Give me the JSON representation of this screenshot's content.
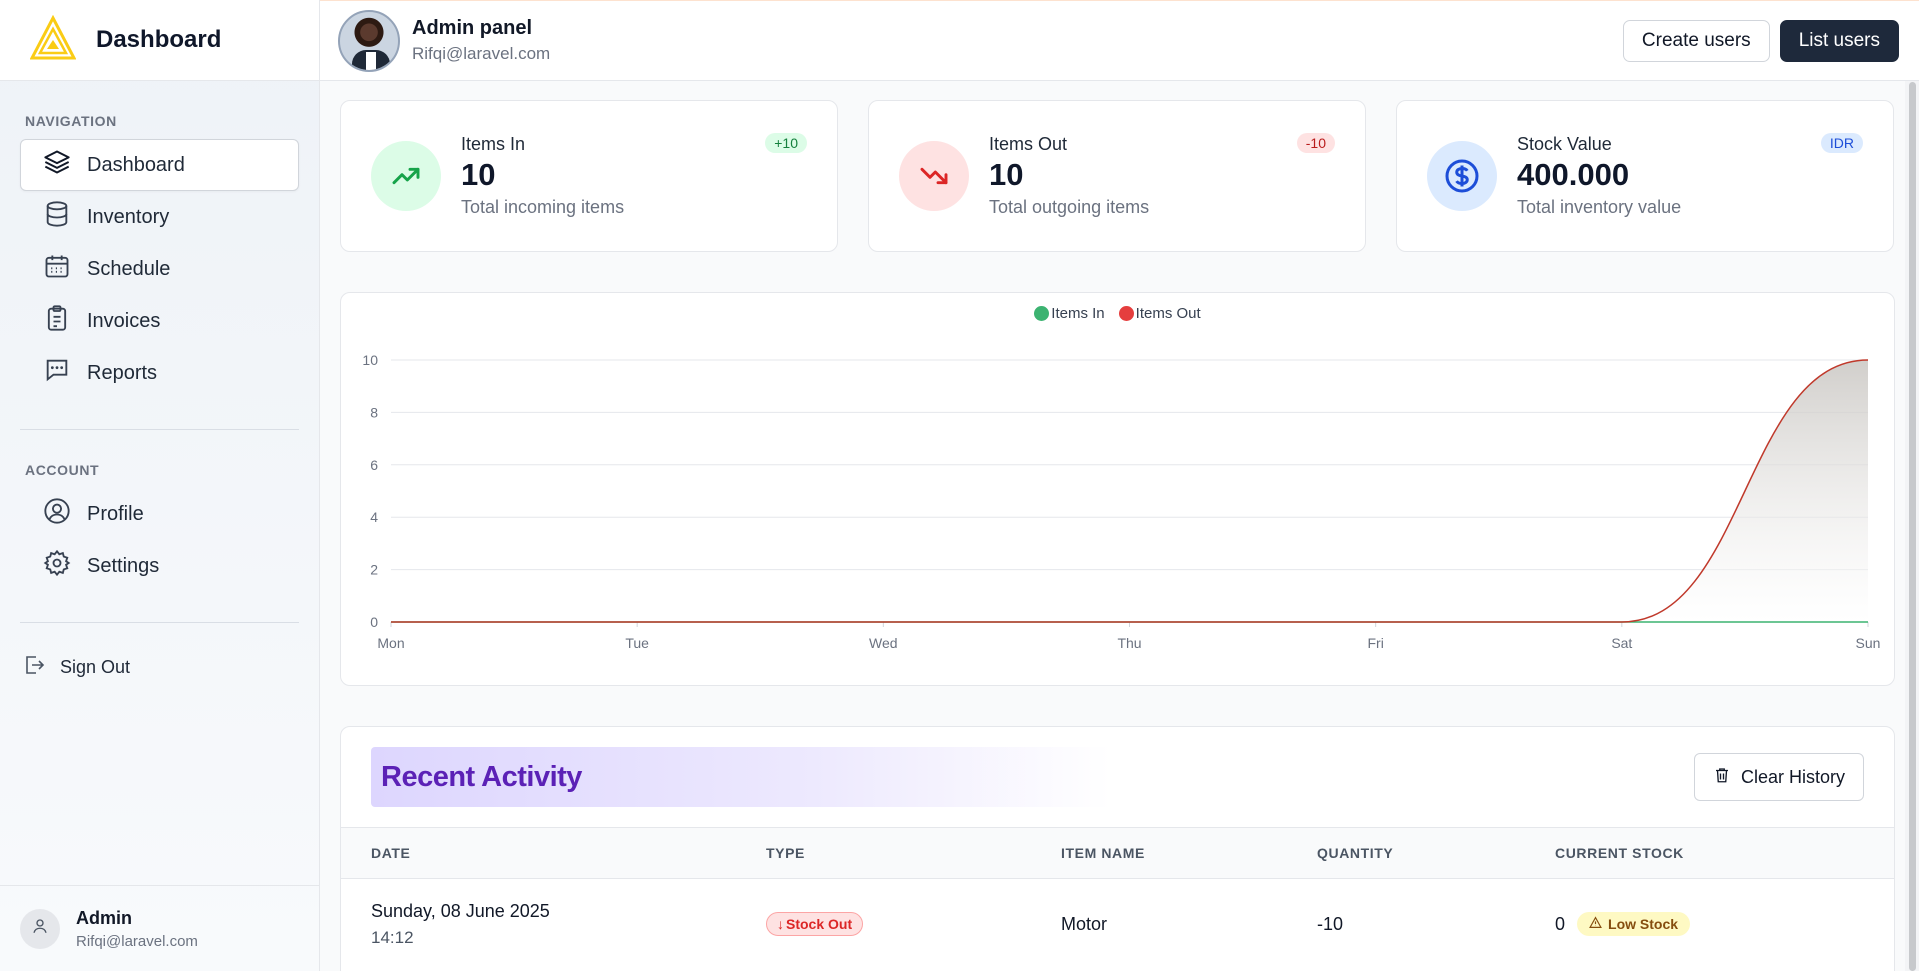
{
  "brand": {
    "title": "Dashboard",
    "accent": "#facc15"
  },
  "sidebar": {
    "navigation_label": "NAVIGATION",
    "nav_items": [
      {
        "label": "Dashboard",
        "icon": "layers-icon",
        "active": true
      },
      {
        "label": "Inventory",
        "icon": "database-icon",
        "active": false
      },
      {
        "label": "Schedule",
        "icon": "calendar-icon",
        "active": false
      },
      {
        "label": "Invoices",
        "icon": "clipboard-icon",
        "active": false
      },
      {
        "label": "Reports",
        "icon": "chat-icon",
        "active": false
      }
    ],
    "account_label": "ACCOUNT",
    "account_items": [
      {
        "label": "Profile",
        "icon": "user-circle-icon"
      },
      {
        "label": "Settings",
        "icon": "gear-icon"
      }
    ],
    "sign_out": "Sign Out",
    "user": {
      "name": "Admin",
      "email": "Rifqi@laravel.com"
    }
  },
  "header": {
    "title": "Admin panel",
    "email": "Rifqi@laravel.com",
    "create_users": "Create users",
    "list_users": "List users"
  },
  "stats": [
    {
      "label": "Items In",
      "value": "10",
      "sub": "Total incoming items",
      "badge": "+10",
      "icon": "trending-up-icon",
      "color": "#16a34a"
    },
    {
      "label": "Items Out",
      "value": "10",
      "sub": "Total outgoing items",
      "badge": "-10",
      "icon": "trending-down-icon",
      "color": "#dc2626"
    },
    {
      "label": "Stock Value",
      "value": "400.000",
      "sub": "Total inventory value",
      "badge": "IDR",
      "icon": "dollar-icon",
      "color": "#1d4ed8"
    }
  ],
  "chart_data": {
    "type": "area",
    "categories": [
      "Mon",
      "Tue",
      "Wed",
      "Thu",
      "Fri",
      "Sat",
      "Sun"
    ],
    "series": [
      {
        "name": "Items In",
        "values": [
          0,
          0,
          0,
          0,
          0,
          0,
          0
        ],
        "color": "#3cb371"
      },
      {
        "name": "Items Out",
        "values": [
          0,
          0,
          0,
          0,
          0,
          0,
          10
        ],
        "color": "#e53e3e"
      }
    ],
    "ylim": [
      0,
      10
    ],
    "yticks": [
      "0",
      "2",
      "4",
      "6",
      "8",
      "10"
    ],
    "grid": true,
    "legend": "top-center"
  },
  "activity": {
    "title": "Recent Activity",
    "clear_button": "Clear History",
    "columns": [
      "DATE",
      "TYPE",
      "ITEM NAME",
      "QUANTITY",
      "CURRENT STOCK"
    ],
    "rows": [
      {
        "date": "Sunday, 08 June 2025",
        "time": "14:12",
        "type": "Stock Out",
        "item": "Motor",
        "quantity": "-10",
        "stock": "0",
        "status": "Low Stock"
      }
    ]
  }
}
